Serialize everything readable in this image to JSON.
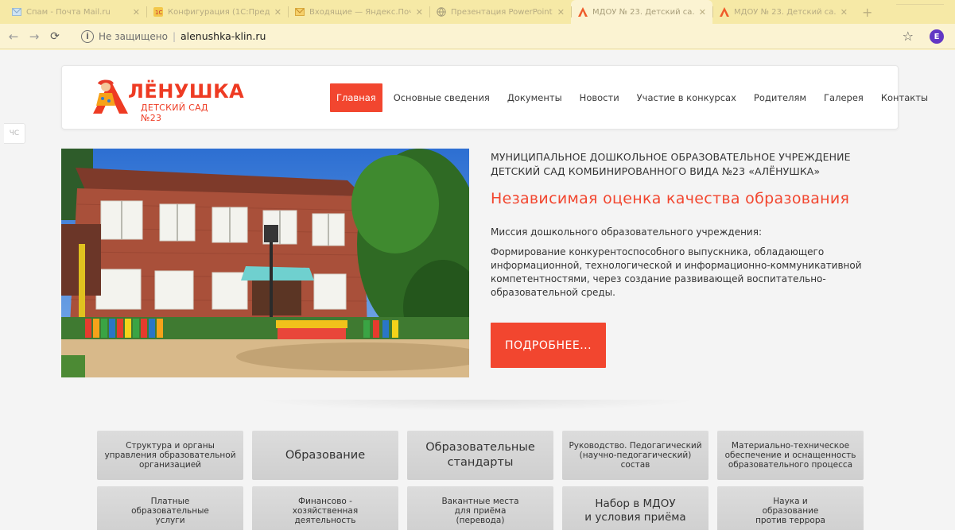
{
  "browser": {
    "tabs": [
      {
        "label": "Спам - Почта Mail.ru",
        "icon": "mail-icon",
        "active": false
      },
      {
        "label": "Конфигурация (1С:Пред...",
        "icon": "1c-icon",
        "active": false
      },
      {
        "label": "Входящие — Яндекс.Поч...",
        "icon": "mail-icon",
        "active": false
      },
      {
        "label": "Презентация PowerPoint",
        "icon": "globe-icon",
        "active": false
      },
      {
        "label": "МДОУ № 23. Детский са...",
        "icon": "site-logo-icon",
        "active": true
      },
      {
        "label": "МДОУ № 23. Детский са...",
        "icon": "site-logo-icon",
        "active": false
      }
    ],
    "new_tab": "+",
    "security_label": "Не защищено",
    "url": "alenushka-klin.ru",
    "profile_initial": "E"
  },
  "side_tab_label": "ЧС",
  "site": {
    "logo": {
      "title": "ЛЁНУШКА",
      "subtitle": "ДЕТСКИЙ САД №23"
    },
    "nav": [
      {
        "label": "Главная",
        "active": true
      },
      {
        "label": "Основные сведения"
      },
      {
        "label": "Документы"
      },
      {
        "label": "Новости"
      },
      {
        "label": "Участие в конкурсах"
      },
      {
        "label": "Родителям"
      },
      {
        "label": "Галерея"
      },
      {
        "label": "Контакты"
      }
    ],
    "hero": {
      "org_name_line1": "МУНИЦИПАЛЬНОЕ ДОШКОЛЬНОЕ ОБРАЗОВАТЕЛЬНОЕ УЧРЕЖДЕНИЕ",
      "org_name_line2": "ДЕТСКИЙ САД КОМБИНИРОВАННОГО ВИДА №23 «АЛЁНУШКА»",
      "headline": "Независимая оценка качества образования",
      "mission_label": "Миссия дошкольного образовательного учреждения:",
      "mission_text": "Формирование конкурентоспособного выпускника, обладающего информационной, технологической и информационно-коммуникативной компетентностями, через создание развивающей воспитательно-образовательной среды.",
      "more_button": "ПОДРОБНЕЕ..."
    },
    "tiles_row1": [
      {
        "label": "Структура и органы\nуправления образовательной\nорганизацией",
        "size": "small"
      },
      {
        "label": "Образование",
        "size": "big"
      },
      {
        "label": "Образовательные\nстандарты",
        "size": "big"
      },
      {
        "label": "Руководство. Педогагический\n(научно-педогагический)\nсостав",
        "size": "small"
      },
      {
        "label": "Материально-техническое\nобеспечение и оснащенность\nобразовательного процесса",
        "size": "small"
      }
    ],
    "tiles_row2": [
      {
        "label": "Платные\nобразовательные\nуслуги",
        "size": "small"
      },
      {
        "label": "Финансово -\nхозяйственная\nдеятельность",
        "size": "small"
      },
      {
        "label": "Вакантные места\nдля приёма\n(перевода)",
        "size": "small"
      },
      {
        "label": "Набор в МДОУ\nи условия приёма",
        "size": "mid"
      },
      {
        "label": "Наука и\nобразование\nпротив террора",
        "size": "small"
      }
    ]
  },
  "colors": {
    "accent": "#f2462f",
    "browser_theme": "#f6e9a6",
    "tile": "#d4d4d4"
  }
}
